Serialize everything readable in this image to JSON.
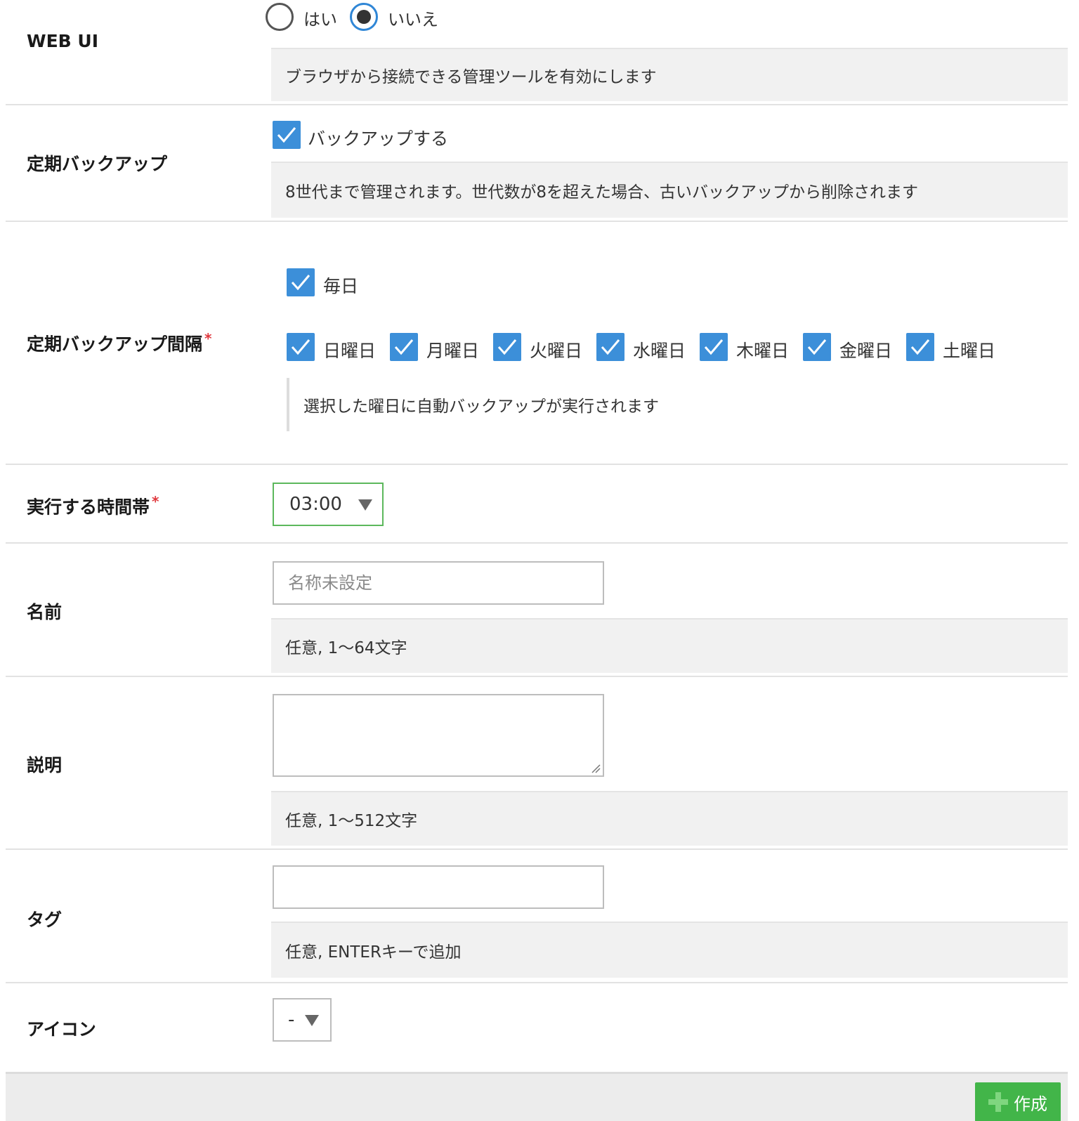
{
  "web_ui": {
    "label": "WEB UI",
    "options": [
      "はい",
      "いいえ"
    ],
    "selected": "いいえ",
    "note": "ブラウザから接続できる管理ツールを有効にします"
  },
  "backup": {
    "label": "定期バックアップ",
    "checkbox_label": "バックアップする",
    "checked": true,
    "note": "8世代まで管理されます。世代数が8を超えた場合、古いバックアップから削除されます"
  },
  "interval": {
    "label": "定期バックアップ間隔",
    "required_mark": "*",
    "daily_label": "毎日",
    "days": [
      "日曜日",
      "月曜日",
      "火曜日",
      "水曜日",
      "木曜日",
      "金曜日",
      "土曜日"
    ],
    "note": "選択した曜日に自動バックアップが実行されます"
  },
  "time": {
    "label": "実行する時間帯",
    "required_mark": "*",
    "value": "03:00"
  },
  "name": {
    "label": "名前",
    "placeholder": "名称未設定",
    "note": "任意, 1〜64文字"
  },
  "description": {
    "label": "説明",
    "note": "任意, 1〜512文字"
  },
  "tags": {
    "label": "タグ",
    "note": "任意, ENTERキーで追加"
  },
  "icon": {
    "label": "アイコン",
    "value": "-"
  },
  "footer": {
    "create_label": "作成"
  },
  "colors": {
    "accent_blue": "#3c8fd9",
    "create_green": "#42b549",
    "required_red": "#e0383e",
    "time_select_border": "#5cb85c"
  }
}
